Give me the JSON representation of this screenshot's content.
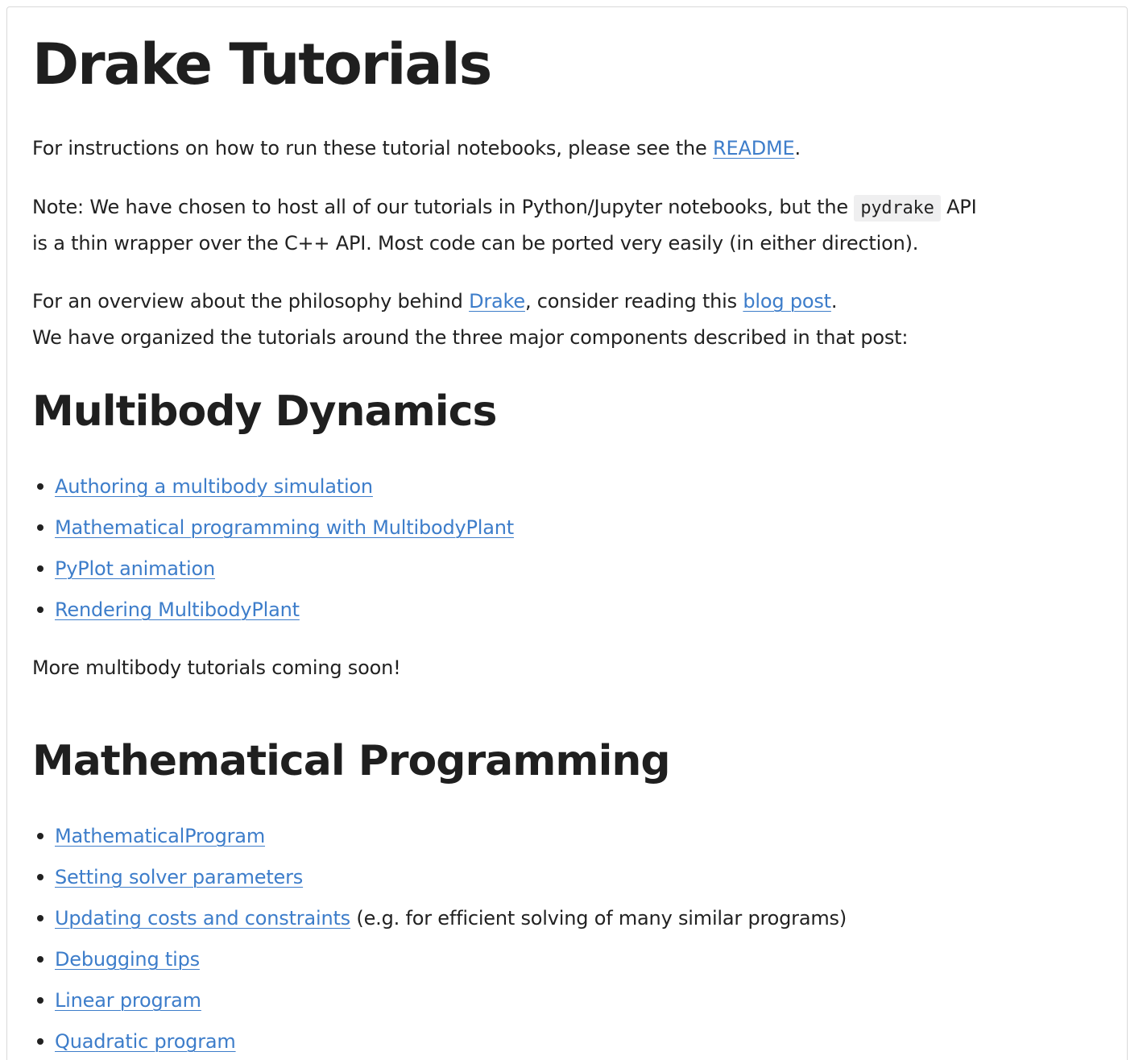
{
  "title": "Drake Tutorials",
  "intro": {
    "readme_prefix": "For instructions on how to run these tutorial notebooks, please see the ",
    "readme_link": "README",
    "readme_suffix": ".",
    "note_prefix": "Note: We have chosen to host all of our tutorials in Python/Jupyter notebooks, but the ",
    "note_code": "pydrake",
    "note_suffix1": " API",
    "note_line2": "is a thin wrapper over the C++ API. Most code can be ported very easily (in either direction).",
    "overview_prefix": "For an overview about the philosophy behind ",
    "overview_link1": "Drake",
    "overview_middle": ", consider reading this ",
    "overview_link2": "blog post",
    "overview_suffix": ".",
    "overview_line2": "We have organized the tutorials around the three major components described in that post:"
  },
  "multibody": {
    "heading": "Multibody Dynamics",
    "items": [
      {
        "link": "Authoring a multibody simulation",
        "extra": ""
      },
      {
        "link": "Mathematical programming with MultibodyPlant",
        "extra": ""
      },
      {
        "link": "PyPlot animation",
        "extra": ""
      },
      {
        "link": "Rendering MultibodyPlant",
        "extra": ""
      }
    ],
    "footer": "More multibody tutorials coming soon!"
  },
  "mathprog": {
    "heading": "Mathematical Programming",
    "items": [
      {
        "link": "MathematicalProgram",
        "extra": ""
      },
      {
        "link": "Setting solver parameters",
        "extra": ""
      },
      {
        "link": "Updating costs and constraints",
        "extra": " (e.g. for efficient solving of many similar programs)"
      },
      {
        "link": "Debugging tips",
        "extra": ""
      },
      {
        "link": "Linear program",
        "extra": ""
      },
      {
        "link": "Quadratic program",
        "extra": ""
      }
    ]
  }
}
